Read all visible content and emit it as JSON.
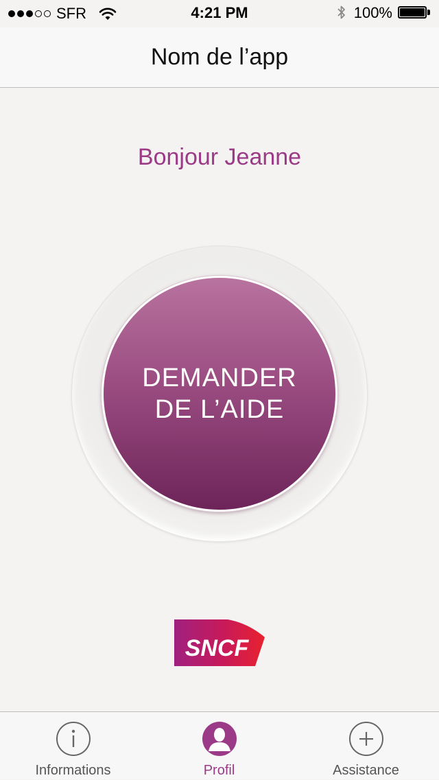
{
  "status_bar": {
    "carrier": "SFR",
    "signal_bars_filled": 3,
    "signal_bars_total": 5,
    "time": "4:21 PM",
    "battery": "100%",
    "icons": [
      "wifi-icon",
      "bluetooth-icon",
      "battery-icon"
    ]
  },
  "nav": {
    "title": "Nom de l’app"
  },
  "greeting": "Bonjour Jeanne",
  "help_button": {
    "line1": "DEMANDER",
    "line2": "DE L’AIDE"
  },
  "logo": {
    "text": "SNCF"
  },
  "tabs": [
    {
      "label": "Informations",
      "icon": "info-icon",
      "active": false
    },
    {
      "label": "Profil",
      "icon": "profile-icon",
      "active": true
    },
    {
      "label": "Assistance",
      "icon": "plus-icon",
      "active": false
    }
  ],
  "colors": {
    "accent": "#9b3a86",
    "button_top": "#b8739f",
    "button_bottom": "#6d2458",
    "background": "#f4f3f1"
  }
}
